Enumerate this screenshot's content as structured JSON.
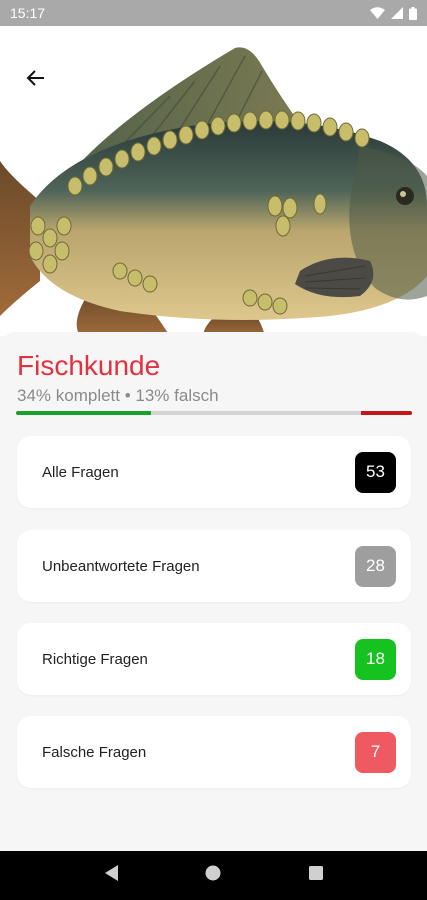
{
  "status": {
    "time": "15:17"
  },
  "topic": {
    "title": "Fischkunde",
    "summary": "34% komplett • 13% falsch",
    "complete_fraction": 0.34,
    "wrong_fraction": 0.13
  },
  "categories": [
    {
      "label": "Alle Fragen",
      "count": "53",
      "color": "#000000"
    },
    {
      "label": "Unbeantwortete Fragen",
      "count": "28",
      "color": "#9e9e9e"
    },
    {
      "label": "Richtige Fragen",
      "count": "18",
      "color": "#16c21f"
    },
    {
      "label": "Falsche Fragen",
      "count": "7",
      "color": "#ef5962"
    }
  ],
  "colors": {
    "accent": "#e2313f",
    "progress_correct": "#17a22a",
    "progress_wrong": "#c2161b"
  },
  "icons": {
    "back": "arrow-left-icon",
    "nav": [
      "nav-back-icon",
      "nav-home-icon",
      "nav-recents-icon"
    ]
  }
}
